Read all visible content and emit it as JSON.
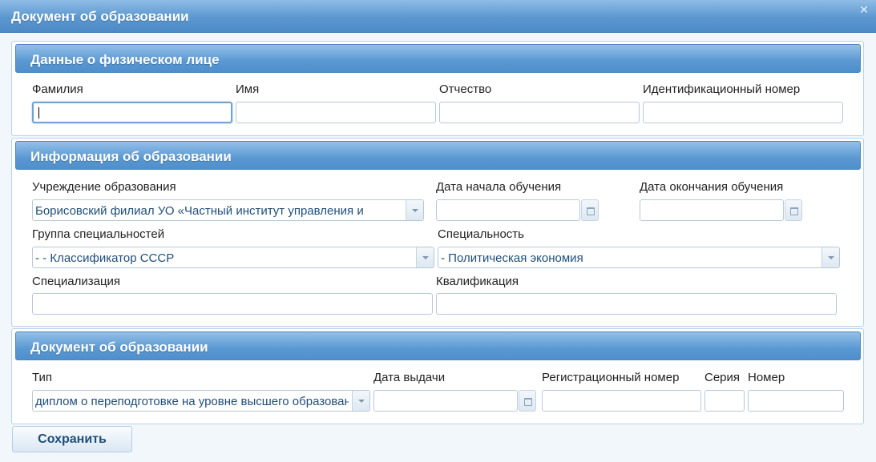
{
  "window": {
    "title": "Документ об образовании",
    "close_icon": "close-icon"
  },
  "person": {
    "header": "Данные о физическом лице",
    "surname_label": "Фамилия",
    "name_label": "Имя",
    "patronymic_label": "Отчество",
    "id_label": "Идентификационный номер",
    "surname_value": "",
    "name_value": "",
    "patronymic_value": "",
    "id_value": ""
  },
  "education": {
    "header": "Информация об образовании",
    "institution_label": "Учреждение образования",
    "institution_value": "Борисовский филиал УО «Частный институт управления и",
    "start_date_label": "Дата начала обучения",
    "start_date_value": "",
    "end_date_label": "Дата окончания обучения",
    "end_date_value": "",
    "group_label": "Группа специальностей",
    "group_value": "- - Классификатор СССР",
    "specialty_label": "Специальность",
    "specialty_value": "- Политическая экономия",
    "specialization_label": "Специализация",
    "specialization_value": "",
    "qualification_label": "Квалификация",
    "qualification_value": ""
  },
  "document": {
    "header": "Документ об образовании",
    "type_label": "Тип",
    "type_value": "диплом о переподготовке на уровне высшего образования",
    "issue_date_label": "Дата выдачи",
    "issue_date_value": "",
    "reg_number_label": "Регистрационный номер",
    "reg_number_value": "",
    "series_label": "Серия",
    "series_value": "",
    "number_label": "Номер",
    "number_value": ""
  },
  "actions": {
    "save_label": "Сохранить"
  },
  "colors": {
    "header_blue": "#5a98d2",
    "text_blue": "#1f4e7a",
    "border": "#b8c8d8"
  }
}
